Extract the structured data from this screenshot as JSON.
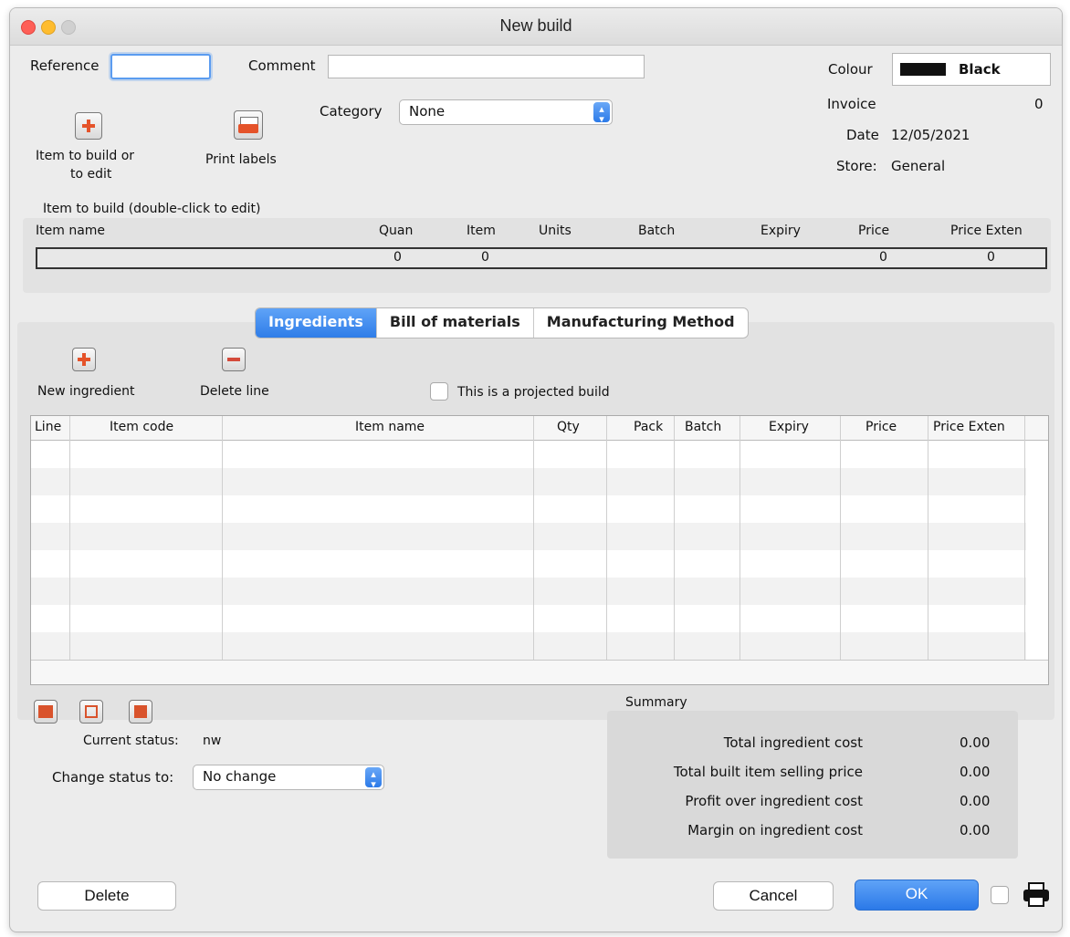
{
  "window": {
    "title": "New build"
  },
  "header": {
    "reference_label": "Reference",
    "reference_value": "",
    "comment_label": "Comment",
    "comment_value": "",
    "category_label": "Category",
    "category_value": "None",
    "colour_label": "Colour",
    "colour_value": "Black",
    "colour_swatch": "#111111",
    "invoice_label": "Invoice",
    "invoice_value": "0",
    "date_label": "Date",
    "date_value": "12/05/2021",
    "store_label": "Store:",
    "store_value": "General"
  },
  "tools": {
    "item_button_label_1": "Item to build or",
    "item_button_label_2": "to edit",
    "print_labels_label": "Print labels"
  },
  "build_item": {
    "section_label": "Item to build (double-click to edit)",
    "columns": [
      "Item name",
      "Quan",
      "Item",
      "Units",
      "Batch",
      "Expiry",
      "Price",
      "Price Exten"
    ],
    "row": {
      "item_name": "",
      "quan": "0",
      "item": "0",
      "units": "",
      "batch": "",
      "expiry": "",
      "price": "0",
      "price_exten": "0"
    }
  },
  "tabs": [
    "Ingredients",
    "Bill of materials",
    "Manufacturing Method"
  ],
  "ingredients": {
    "new_label": "New ingredient",
    "delete_label": "Delete line",
    "projected_label": "This is a projected build",
    "projected_checked": false,
    "columns": [
      "Line",
      "Item code",
      "Item name",
      "Qty",
      "Pack",
      "Batch",
      "Expiry",
      "Price",
      "Price Exten"
    ],
    "rows": []
  },
  "status": {
    "current_label": "Current status:",
    "current_value": "nw",
    "change_label": "Change status to:",
    "change_value": "No change"
  },
  "summary": {
    "title": "Summary",
    "rows": [
      {
        "label": "Total ingredient cost",
        "value": "0.00"
      },
      {
        "label": "Total built item selling price",
        "value": "0.00"
      },
      {
        "label": "Profit over ingredient cost",
        "value": "0.00"
      },
      {
        "label": "Margin on ingredient cost",
        "value": "0.00"
      }
    ]
  },
  "footer": {
    "delete_label": "Delete",
    "cancel_label": "Cancel",
    "ok_label": "OK",
    "print_checked": false
  },
  "colors": {
    "accent": "#2f7de8",
    "close": "#fe5f57",
    "minimize": "#febc2e",
    "zoom": "#d0d0d0"
  }
}
